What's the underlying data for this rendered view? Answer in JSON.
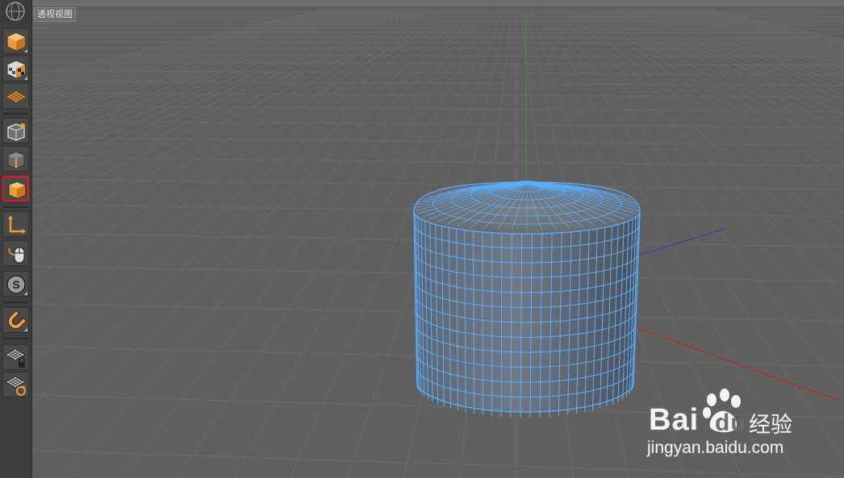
{
  "app": {
    "logo_icon": "cinema4d-logo-icon"
  },
  "viewport": {
    "label": "透视视图",
    "background": "#606060",
    "grid_color": "#6a6a6a"
  },
  "toolbar": {
    "tools": [
      {
        "name": "model-mode",
        "icon": "orange-cube-icon",
        "active": false
      },
      {
        "name": "texture-mode",
        "icon": "checker-cube-icon",
        "active": false
      },
      {
        "name": "workplane-mode",
        "icon": "orange-grid-icon",
        "active": false
      },
      {
        "name": "points-mode",
        "icon": "cube-points-icon",
        "active": false
      },
      {
        "name": "edges-mode",
        "icon": "cube-edges-icon",
        "active": false
      },
      {
        "name": "polygons-mode",
        "icon": "cube-polygons-icon",
        "active": true
      },
      {
        "name": "axis-mode",
        "icon": "axis-icon",
        "active": false
      },
      {
        "name": "tweak-mode",
        "icon": "mouse-icon",
        "active": false
      },
      {
        "name": "solo-mode",
        "icon": "solo-s-icon",
        "active": false
      },
      {
        "name": "snap-mode",
        "icon": "magnet-icon",
        "active": false
      },
      {
        "name": "lock-workplane",
        "icon": "grid-lock-icon",
        "active": false
      },
      {
        "name": "align-workplane",
        "icon": "grid-refresh-icon",
        "active": false
      }
    ]
  },
  "axes": {
    "x_color": "#d12020",
    "y_color": "#1fa02f",
    "z_color": "#2c2cc8"
  },
  "object": {
    "type": "cylinder",
    "wire_color": "#5aaeff"
  },
  "watermark": {
    "brand": "Bai",
    "brand_suffix": "du",
    "product": "经验",
    "url": "jingyan.baidu.com"
  }
}
